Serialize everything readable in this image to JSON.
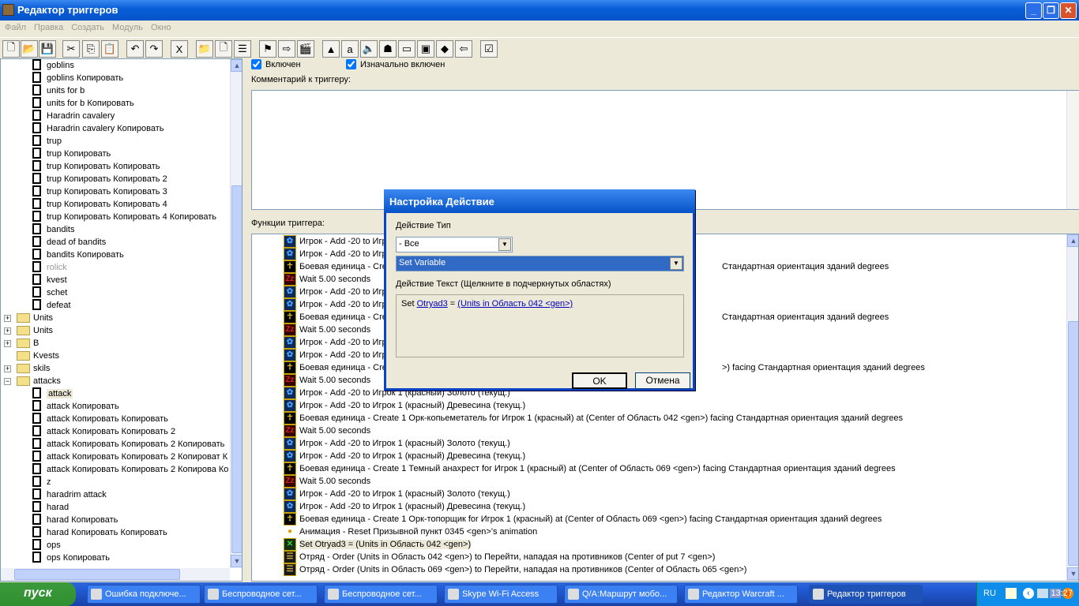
{
  "window": {
    "title": "Редактор триггеров",
    "min": "_",
    "max": "❐",
    "close": "✕"
  },
  "menu": [
    "Файл",
    "Правка",
    "Создать",
    "Модуль",
    "Окно"
  ],
  "toolbar": [
    "new-icon",
    "open-icon",
    "save-icon",
    "cut-icon",
    "copy-icon",
    "paste-icon",
    "undo-icon",
    "redo-icon",
    "x-icon",
    "folder-icon",
    "trigger-icon",
    "comment-icon",
    "event-icon",
    "action-icon",
    "condition-icon",
    "terrain-icon",
    "text-icon",
    "sound-icon",
    "object-icon",
    "camera-icon",
    "region-icon",
    "import-icon",
    "variable-icon",
    "test-icon"
  ],
  "tree": {
    "items": [
      {
        "label": "goblins",
        "type": "doc"
      },
      {
        "label": "goblins Копировать",
        "type": "doc"
      },
      {
        "label": "units for b",
        "type": "doc"
      },
      {
        "label": "units for b Копировать",
        "type": "doc"
      },
      {
        "label": "Haradrin cavalery",
        "type": "doc"
      },
      {
        "label": "Haradrin cavalery Копировать",
        "type": "doc"
      },
      {
        "label": "trup",
        "type": "doc"
      },
      {
        "label": "trup Копировать",
        "type": "doc"
      },
      {
        "label": "trup Копировать Копировать",
        "type": "doc"
      },
      {
        "label": "trup Копировать Копировать 2",
        "type": "doc"
      },
      {
        "label": "trup Копировать Копировать 3",
        "type": "doc"
      },
      {
        "label": "trup Копировать Копировать 4",
        "type": "doc"
      },
      {
        "label": "trup Копировать Копировать 4 Копировать",
        "type": "doc"
      },
      {
        "label": "bandits",
        "type": "doc"
      },
      {
        "label": "dead of bandits",
        "type": "doc"
      },
      {
        "label": "bandits Копировать",
        "type": "doc"
      },
      {
        "label": "rolick",
        "type": "doc",
        "disabled": true
      },
      {
        "label": "kvest",
        "type": "doc"
      },
      {
        "label": "schet",
        "type": "doc"
      },
      {
        "label": "defeat",
        "type": "doc"
      },
      {
        "label": "Units",
        "type": "folder",
        "pm": "+"
      },
      {
        "label": "Units",
        "type": "folder",
        "pm": "+"
      },
      {
        "label": "B",
        "type": "folder",
        "pm": "+"
      },
      {
        "label": "Kvests",
        "type": "folder"
      },
      {
        "label": "skils",
        "type": "folder",
        "pm": "+"
      },
      {
        "label": "attacks",
        "type": "folder",
        "pm": "−"
      },
      {
        "label": "attack",
        "type": "doc",
        "selected": true
      },
      {
        "label": "attack Копировать",
        "type": "doc"
      },
      {
        "label": "attack Копировать Копировать",
        "type": "doc"
      },
      {
        "label": "attack Копировать Копировать 2",
        "type": "doc"
      },
      {
        "label": "attack Копировать Копировать 2 Копировать",
        "type": "doc"
      },
      {
        "label": "attack Копировать Копировать 2 Копироват К",
        "type": "doc"
      },
      {
        "label": "attack Копировать Копировать 2 Копирова Ко",
        "type": "doc"
      },
      {
        "label": "z",
        "type": "doc"
      },
      {
        "label": "haradrim attack",
        "type": "doc"
      },
      {
        "label": "harad",
        "type": "doc"
      },
      {
        "label": "harad Копировать",
        "type": "doc"
      },
      {
        "label": "harad Копировать Копировать",
        "type": "doc"
      },
      {
        "label": "ops",
        "type": "doc"
      },
      {
        "label": "ops Копировать",
        "type": "doc"
      }
    ]
  },
  "trigger": {
    "enabled_label": "Включен",
    "initially_label": "Изначально включен",
    "comment_label": "Комментарий к триггеру:",
    "functions_label": "Функции триггера:"
  },
  "actions": [
    {
      "icon": "player",
      "text": "Игрок - Add -20 to Игр"
    },
    {
      "icon": "player",
      "text": "Игрок - Add -20 to Игр"
    },
    {
      "icon": "unit",
      "text": "Боевая единица - Cre",
      "tail": "Стандартная ориентация зданий degrees"
    },
    {
      "icon": "wait",
      "text": "Wait 5.00 seconds"
    },
    {
      "icon": "player",
      "text": "Игрок - Add -20 to Игр"
    },
    {
      "icon": "player",
      "text": "Игрок - Add -20 to Игр"
    },
    {
      "icon": "unit",
      "text": "Боевая единица - Cre",
      "tail": "Стандартная ориентация зданий degrees"
    },
    {
      "icon": "wait",
      "text": "Wait 5.00 seconds"
    },
    {
      "icon": "player",
      "text": "Игрок - Add -20 to Игр"
    },
    {
      "icon": "player",
      "text": "Игрок - Add -20 to Игр"
    },
    {
      "icon": "unit",
      "text": "Боевая единица - Cre",
      "tail": ">) facing Стандартная ориентация зданий degrees"
    },
    {
      "icon": "wait",
      "text": "Wait 5.00 seconds"
    },
    {
      "icon": "player",
      "text": "Игрок - Add -20 to Игрок 1 (красный) Золото (текущ.)"
    },
    {
      "icon": "player",
      "text": "Игрок - Add -20 to Игрок 1 (красный) Древесина (текущ.)"
    },
    {
      "icon": "unit",
      "text": "Боевая единица - Create 1 Орк-копьеметатель for Игрок 1 (красный) at (Center of Область 042 <gen>) facing Стандартная ориентация зданий degrees"
    },
    {
      "icon": "wait",
      "text": "Wait 5.00 seconds"
    },
    {
      "icon": "player",
      "text": "Игрок - Add -20 to Игрок 1 (красный) Золото (текущ.)"
    },
    {
      "icon": "player",
      "text": "Игрок - Add -20 to Игрок 1 (красный) Древесина (текущ.)"
    },
    {
      "icon": "unit",
      "text": "Боевая единица - Create 1 Темный анахрест for Игрок 1 (красный) at (Center of Область 069 <gen>) facing Стандартная ориентация зданий degrees"
    },
    {
      "icon": "wait",
      "text": "Wait 5.00 seconds"
    },
    {
      "icon": "player",
      "text": "Игрок - Add -20 to Игрок 1 (красный) Золото (текущ.)"
    },
    {
      "icon": "player",
      "text": "Игрок - Add -20 to Игрок 1 (красный) Древесина (текущ.)"
    },
    {
      "icon": "unit",
      "text": "Боевая единица - Create 1 Орк-топорщик for Игрок 1 (красный) at (Center of Область 069 <gen>) facing Стандартная ориентация зданий degrees"
    },
    {
      "icon": "anim",
      "text": "Анимация - Reset Призывной пункт 0345 <gen>'s animation"
    },
    {
      "icon": "set",
      "text": "Set Otryad3 = (Units in Область 042 <gen>)",
      "selected": true
    },
    {
      "icon": "group",
      "text": "Отряд - Order (Units in Область 042 <gen>) to Перейти, нападая на противников (Center of put 7 <gen>)"
    },
    {
      "icon": "group",
      "text": "Отряд - Order (Units in Область 069 <gen>) to Перейти, нападая на противников (Center of Область 065 <gen>)"
    }
  ],
  "dialog": {
    "title": "Настройка Действие",
    "type_label": "Действие Тип",
    "category": "- Все",
    "action": "Set Variable",
    "text_label": "Действие Текст (Щелкните в подчеркнутых областях)",
    "set_word": "Set",
    "var_link": "Otryad3",
    "eq": "=",
    "value_link": "(Units in Область 042 <gen>)",
    "ok": "OK",
    "cancel": "Отмена"
  },
  "taskbar": {
    "start": "пуск",
    "tasks": [
      "Ошибка подключе...",
      "Беспроводное сет...",
      "Беспроводное сет...",
      "Skype Wi-Fi Access",
      "Q/A:Маршрут мобо...",
      "Редактор Warcraft ...",
      "Редактор триггеров"
    ],
    "lang": "RU",
    "clock": "13:27",
    "badge": "6"
  }
}
